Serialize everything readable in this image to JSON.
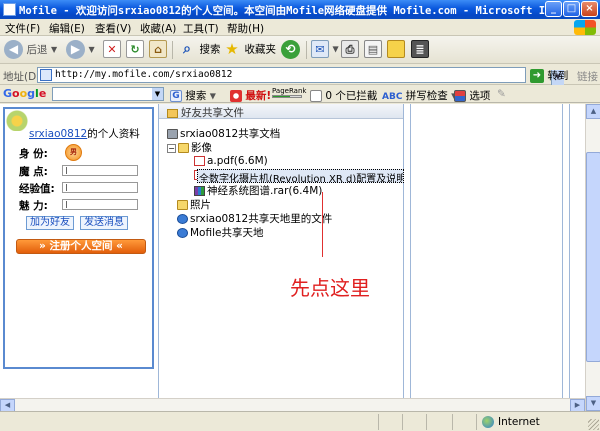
{
  "window": {
    "title": "Mofile - 欢迎访问srxiao0812的个人空间。本空间由Mofile网络硬盘提供 Mofile.com - Microsoft I...",
    "min_glyph": "_",
    "max_glyph": "□",
    "close_glyph": "×"
  },
  "menu": {
    "file": "文件(F)",
    "edit": "编辑(E)",
    "view": "查看(V)",
    "favorites": "收藏(A)",
    "tools": "工具(T)",
    "help": "帮助(H)"
  },
  "toolbar": {
    "back": "后退",
    "search": "搜索",
    "favorites": "收藏夹"
  },
  "address": {
    "label": "地址(D)",
    "url": "http://my.mofile.com/srxiao0812",
    "go": "转到",
    "links": "链接"
  },
  "googlebar": {
    "logo": [
      "G",
      "o",
      "o",
      "g",
      "l",
      "e"
    ],
    "search": "搜索",
    "latest": "最新!",
    "pagerank": "PageRank",
    "blocked": "0 个已拦截",
    "spellcheck": "拼写检查",
    "options": "选项"
  },
  "profile": {
    "username": "srxiao0812",
    "title_suffix": "的个人资料",
    "identity_label": "身  份:",
    "gender_badge": "男",
    "charm_points_label": "魔  点:",
    "experience_label": "经验值:",
    "charm_label": "魅  力:",
    "add_friend": "加为好友",
    "send_message": "发送消息",
    "register": "» 注册个人空间 «"
  },
  "files": {
    "header": "好友共享文件",
    "root": "srxiao0812共享文档",
    "video_folder": "影像",
    "pdf_file": "a.pdf(6.6M)",
    "selected_file": "全数字化摄片机(Revolution  XR  d)配置及说明",
    "rar_file": "神经系统图谱.rar(6.4M)",
    "photos_folder": "照片",
    "shared_world": "srxiao0812共享天地里的文件",
    "mofile_world": "Mofile共享天地"
  },
  "annotation": {
    "hint": "先点这里",
    "color": "#e02020"
  },
  "status": {
    "zone": "Internet"
  }
}
